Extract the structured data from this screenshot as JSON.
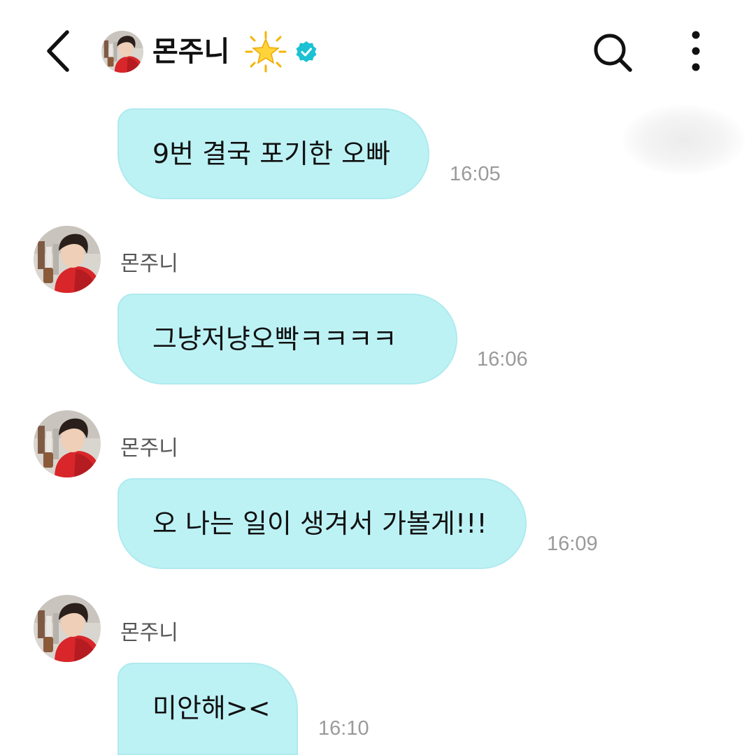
{
  "header": {
    "back_icon": "chevron-left-icon",
    "contact_name": "몬주니",
    "star_icon": "glowing-star-icon",
    "verified_icon": "verified-badge-icon",
    "verified_color": "#1cc1d3",
    "search_icon": "search-icon",
    "more_icon": "more-vertical-icon"
  },
  "colors": {
    "bubble": "#bdf2f5",
    "bubble_border": "#aeeaee",
    "timestamp": "#9a9a9a"
  },
  "messages": [
    {
      "sender": "",
      "text": "9번 결국 포기한 오빠",
      "time": "16:05"
    },
    {
      "sender": "몬주니",
      "text": "그냥저냥오빡ㅋㅋㅋㅋ",
      "time": "16:06"
    },
    {
      "sender": "몬주니",
      "text": "오 나는 일이 생겨서 가볼게!!!",
      "time": "16:09"
    },
    {
      "sender": "몬주니",
      "text": "미안해><",
      "time": "16:10"
    }
  ]
}
